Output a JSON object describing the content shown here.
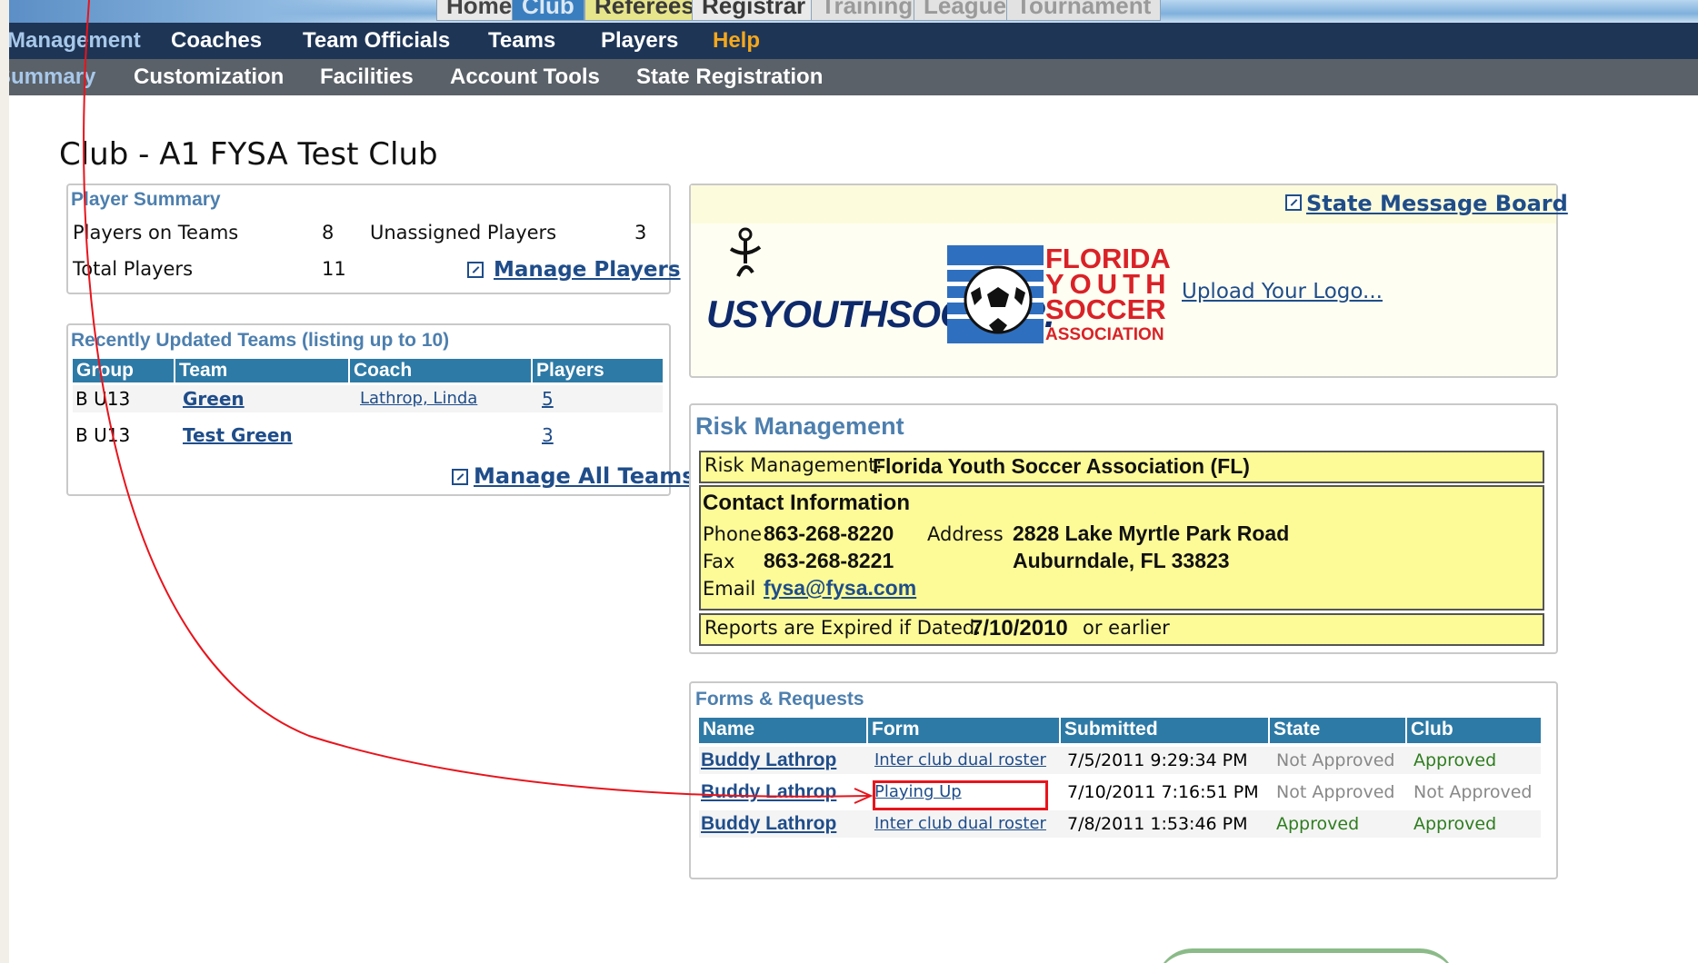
{
  "top_tabs": [
    {
      "label": "Home",
      "bg": "#e8e8e8",
      "color": "#444"
    },
    {
      "label": "Club",
      "bg": "#3a7ebf",
      "color": "#dbe8f4"
    },
    {
      "label": "Referees",
      "bg": "#e7e58b",
      "color": "#3a3a3a"
    },
    {
      "label": "Registrar",
      "bg": "#eaeaea",
      "color": "#3a3a3a"
    },
    {
      "label": "Training",
      "bg": "#e2e2e2",
      "color": "#9a9a9a"
    },
    {
      "label": "League",
      "bg": "#e2e2e2",
      "color": "#9a9a9a"
    },
    {
      "label": "Tournament",
      "bg": "#e2e2e2",
      "color": "#9a9a9a"
    }
  ],
  "nav_primary": [
    "Management",
    "Coaches",
    "Team Officials",
    "Teams",
    "Players",
    "Help"
  ],
  "nav_secondary": [
    "Summary",
    "Customization",
    "Facilities",
    "Account Tools",
    "State Registration"
  ],
  "page_title": "Club - A1 FYSA Test Club",
  "player_summary": {
    "title": "Player Summary",
    "players_on_teams_label": "Players on Teams",
    "players_on_teams": "8",
    "unassigned_label": "Unassigned Players",
    "unassigned": "3",
    "total_label": "Total Players",
    "total": "11",
    "manage_link": "Manage Players"
  },
  "recent_teams": {
    "title": "Recently Updated Teams (listing up to 10)",
    "columns": [
      "Group",
      "Team",
      "Coach",
      "Players"
    ],
    "rows": [
      {
        "group": "B U13",
        "team": "Green",
        "coach": "Lathrop, Linda",
        "players": "5"
      },
      {
        "group": "B U13",
        "team": "Test Green",
        "coach": "",
        "players": "3"
      }
    ],
    "manage_link": "Manage All Teams"
  },
  "logo_box": {
    "message_board_link": "State Message Board",
    "usys_logo": "USYOUTHSOCCER.",
    "fysa_lines": [
      "FLORIDA",
      "YOUTH",
      "SOCCER",
      "ASSOCIATION"
    ],
    "upload_link": "Upload Your Logo..."
  },
  "risk_management": {
    "title": "Risk Management",
    "rm_label": "Risk Management:",
    "rm_value": "Florida Youth Soccer Association (FL)",
    "contact_title": "Contact Information",
    "phone_label": "Phone",
    "phone": "863-268-8220",
    "address_label": "Address",
    "address_line1": "2828 Lake Myrtle Park Road",
    "address_line2": "Auburndale, FL 33823",
    "fax_label": "Fax",
    "fax": "863-268-8221",
    "email_label": "Email",
    "email": "fysa@fysa.com",
    "expired_prefix": "Reports are Expired if Dated:",
    "expired_date": "7/10/2010",
    "expired_suffix": "or earlier"
  },
  "forms": {
    "title": "Forms & Requests",
    "columns": [
      "Name",
      "Form",
      "Submitted",
      "State",
      "Club"
    ],
    "rows": [
      {
        "name": "Buddy Lathrop",
        "form": "Inter club dual roster",
        "submitted": "7/5/2011 9:29:34 PM",
        "state": "Not Approved",
        "club": "Approved"
      },
      {
        "name": "Buddy Lathrop",
        "form": "Playing Up",
        "submitted": "7/10/2011 7:16:51 PM",
        "state": "Not Approved",
        "club": "Not Approved"
      },
      {
        "name": "Buddy Lathrop",
        "form": "Inter club dual roster",
        "submitted": "7/8/2011 1:53:46 PM",
        "state": "Approved",
        "club": "Approved"
      }
    ]
  },
  "colors": {
    "nav_dark": "#1e3556",
    "nav_gray": "#5a6168",
    "table_header": "#2e7aa6",
    "link": "#1f4d8a",
    "highlight_box": "#e8141c",
    "annotation_line": "#e8141c"
  }
}
